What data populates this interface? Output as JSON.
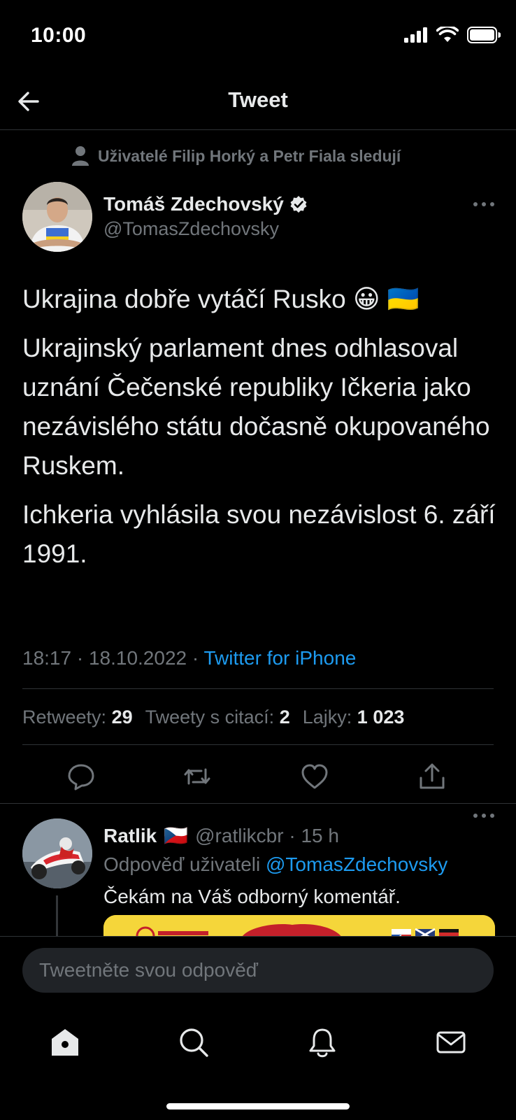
{
  "status_bar": {
    "time": "10:00"
  },
  "header": {
    "title": "Tweet"
  },
  "tweet": {
    "social_context": "Uživatelé Filip Horký a Petr Fiala sledují",
    "author_name": "Tomáš Zdechovský",
    "author_handle": "@TomasZdechovsky",
    "paragraphs": [
      "Ukrajina dobře vytáčí Rusko 😀 🇺🇦",
      "Ukrajinský parlament dnes odhlasoval uznání Čečenské republiky Ičkeria jako nezávislého státu dočasně okupovaného Ruskem.",
      "Ichkeria vyhlásila svou nezávislost 6. září 1991."
    ],
    "timestamp": "18:17 · 18.10.2022 · ",
    "source": "Twitter for iPhone",
    "stats": {
      "retweets_label": "Retweety:",
      "retweets": "29",
      "quotes_label": "Tweety s citací:",
      "quotes": "2",
      "likes_label": "Lajky:",
      "likes": "1 023"
    }
  },
  "reply": {
    "name": "Ratlik",
    "flag": "🇨🇿",
    "meta": "@ratlikcbr · 15 h",
    "replying_prefix": "Odpověď uživateli ",
    "replying_handle": "@TomasZdechovsky",
    "text": "Čekám na Váš odborný komentář."
  },
  "composer": {
    "placeholder": "Tweetněte svou odpověď"
  },
  "colors": {
    "accent": "#1d9bf0",
    "background": "#000000",
    "muted": "#71767b",
    "text": "#e7e9ea"
  },
  "icons": [
    "back-arrow-icon",
    "person-icon",
    "verified-badge-icon",
    "more-icon",
    "reply-icon",
    "retweet-icon",
    "like-icon",
    "share-icon",
    "home-icon",
    "search-icon",
    "notifications-icon",
    "messages-icon"
  ]
}
